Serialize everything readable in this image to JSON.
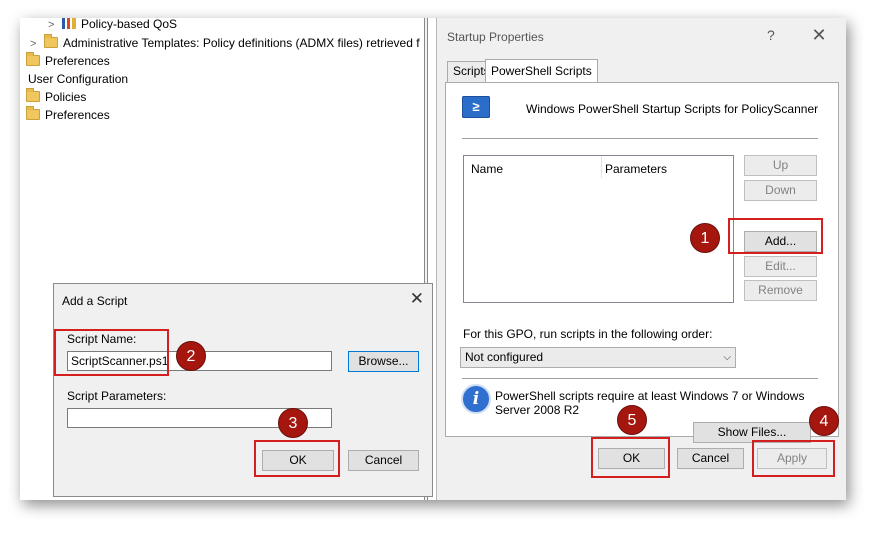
{
  "tree": {
    "items": [
      {
        "label": "Policy-based QoS"
      },
      {
        "label": "Administrative Templates: Policy definitions (ADMX files) retrieved f"
      },
      {
        "label": "Preferences"
      },
      {
        "label": "User Configuration"
      },
      {
        "label": "Policies"
      },
      {
        "label": "Preferences"
      }
    ]
  },
  "startup_properties": {
    "title": "Startup Properties",
    "help": "?",
    "close": "✕",
    "tabs": [
      {
        "label": "Scripts"
      },
      {
        "label": "PowerShell Scripts"
      }
    ],
    "heading": "Windows PowerShell Startup Scripts for PolicyScanner",
    "columns": {
      "name": "Name",
      "parameters": "Parameters"
    },
    "buttons": {
      "up": "Up",
      "down": "Down",
      "add": "Add...",
      "edit": "Edit...",
      "remove": "Remove",
      "show_files": "Show Files...",
      "ok": "OK",
      "cancel": "Cancel",
      "apply": "Apply"
    },
    "order_label": "For this GPO, run scripts in the following order:",
    "order_value": "Not configured",
    "info_text": "PowerShell scripts require at least Windows 7 or Windows Server 2008 R2",
    "icon_glyph": "≥"
  },
  "add_script": {
    "title": "Add a Script",
    "close": "✕",
    "script_name_label": "Script Name:",
    "script_name_value": "ScriptScanner.ps1",
    "browse": "Browse...",
    "params_label": "Script Parameters:",
    "params_value": "",
    "ok": "OK",
    "cancel": "Cancel"
  },
  "callouts": [
    "1",
    "2",
    "3",
    "4",
    "5"
  ],
  "colors": {
    "highlight": "#d41f1f",
    "badge": "#a5160f"
  }
}
